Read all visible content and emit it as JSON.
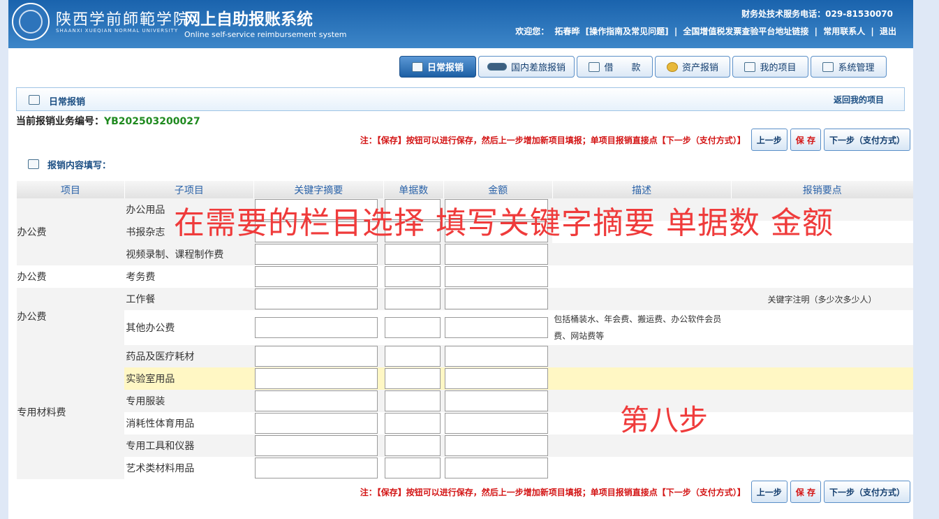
{
  "header": {
    "university_name": "陕西学前師範学院",
    "university_en": "SHAANXI XUEQIAN NORMAL UNIVERSITY",
    "system_title": "网上自助报账系统",
    "system_en": "Online self-service reimbursement system",
    "phone": "财务处技术服务电话：029-81530070",
    "welcome": "欢迎您：",
    "user": "拓春晔",
    "links": [
      "[操作指南及常见问题]",
      "全国增值税发票查验平台地址链接",
      "常用联系人",
      "退出"
    ]
  },
  "nav": {
    "tabs": [
      {
        "label": "日常报销",
        "icon": "book-icon",
        "active": true
      },
      {
        "label": "国内差旅报销",
        "icon": "train-icon",
        "active": false
      },
      {
        "label": "借　　款",
        "icon": "money-icon",
        "active": false
      },
      {
        "label": "资产报销",
        "icon": "coin-icon",
        "active": false
      },
      {
        "label": "我的项目",
        "icon": "list-icon",
        "active": false
      },
      {
        "label": "系统管理",
        "icon": "monitor-icon",
        "active": false
      }
    ]
  },
  "panel": {
    "title": "日常报销",
    "back_link": "返回我的项目"
  },
  "business": {
    "label": "当前报销业务编号：",
    "number": "YB202503200027"
  },
  "note": "注：【保存】按钮可以进行保存，然后上一步增加新项目填报；单项目报销直接点【下一步（支付方式）】",
  "actions": {
    "prev": "上一步",
    "save": "保 存",
    "next": "下一步（支付方式）"
  },
  "section": {
    "title": "报销内容填写："
  },
  "table": {
    "headers": [
      "项目",
      "子项目",
      "关键字摘要",
      "单据数",
      "金额",
      "描述",
      "报销要点"
    ],
    "rows": [
      {
        "category": "办公费",
        "sub": "办公用品",
        "desc": "",
        "req": ""
      },
      {
        "category": "",
        "sub": "书报杂志",
        "desc": "",
        "req": ""
      },
      {
        "category": "",
        "sub": "视频录制、课程制作费",
        "desc": "",
        "req": ""
      },
      {
        "category": "办公费",
        "sub": "考务费",
        "desc": "",
        "req": ""
      },
      {
        "category": "办公费",
        "sub": "工作餐",
        "desc": "",
        "req": "关键字注明（多少次多少人）"
      },
      {
        "category": "",
        "sub": "其他办公费",
        "desc": "包括桶装水、年会费、搬运费、办公软件会员费、网站费等",
        "req": ""
      },
      {
        "category": "专用材料费",
        "sub": "药品及医疗耗材",
        "desc": "",
        "req": ""
      },
      {
        "category": "",
        "sub": "实验室用品",
        "desc": "",
        "req": ""
      },
      {
        "category": "",
        "sub": "专用服装",
        "desc": "",
        "req": ""
      },
      {
        "category": "",
        "sub": "消耗性体育用品",
        "desc": "",
        "req": ""
      },
      {
        "category": "",
        "sub": "专用工具和仪器",
        "desc": "",
        "req": ""
      },
      {
        "category": "",
        "sub": "艺术类材料用品",
        "desc": "",
        "req": ""
      }
    ]
  },
  "annotations": {
    "top": "在需要的栏目选择 填写关键字摘要 单据数 金额",
    "step": "第八步"
  }
}
